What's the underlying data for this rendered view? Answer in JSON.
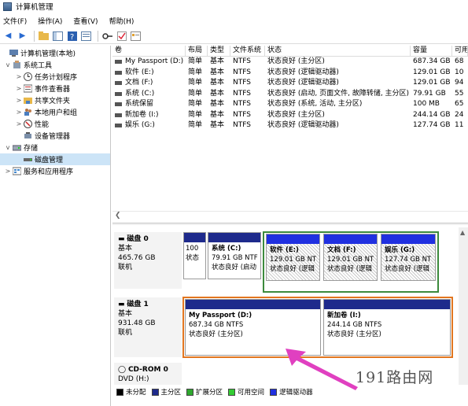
{
  "window": {
    "title": "计算机管理"
  },
  "menu": [
    "文件(F)",
    "操作(A)",
    "查看(V)",
    "帮助(H)"
  ],
  "toolbar": {
    "icons": [
      "back-arrow-icon",
      "forward-arrow-icon",
      "up-folder-icon",
      "show-tree-icon",
      "help-icon",
      "properties-icon",
      "key-icon",
      "check-icon",
      "list-icon"
    ]
  },
  "tree": {
    "items": [
      {
        "label": "计算机管理(本地)",
        "indent": 0,
        "expander": "",
        "icon": "computer-management-icon"
      },
      {
        "label": "系统工具",
        "indent": 1,
        "expander": "v",
        "icon": "tools-icon"
      },
      {
        "label": "任务计划程序",
        "indent": 2,
        "expander": ">",
        "icon": "clock-icon"
      },
      {
        "label": "事件查看器",
        "indent": 2,
        "expander": ">",
        "icon": "event-viewer-icon"
      },
      {
        "label": "共享文件夹",
        "indent": 2,
        "expander": ">",
        "icon": "shared-folder-icon"
      },
      {
        "label": "本地用户和组",
        "indent": 2,
        "expander": ">",
        "icon": "users-icon"
      },
      {
        "label": "性能",
        "indent": 2,
        "expander": ">",
        "icon": "performance-icon"
      },
      {
        "label": "设备管理器",
        "indent": 2,
        "expander": "",
        "icon": "device-manager-icon"
      },
      {
        "label": "存储",
        "indent": 1,
        "expander": "v",
        "icon": "storage-icon"
      },
      {
        "label": "磁盘管理",
        "indent": 2,
        "expander": "",
        "icon": "disk-icon",
        "selected": true
      },
      {
        "label": "服务和应用程序",
        "indent": 1,
        "expander": ">",
        "icon": "services-icon"
      }
    ]
  },
  "volumes": {
    "columns": [
      "卷",
      "布局",
      "类型",
      "文件系统",
      "状态",
      "容量",
      "可用"
    ],
    "rows": [
      [
        "My Passport (D:)",
        "简单",
        "基本",
        "NTFS",
        "状态良好 (主分区)",
        "687.34 GB",
        "68"
      ],
      [
        "软件 (E:)",
        "简单",
        "基本",
        "NTFS",
        "状态良好 (逻辑驱动器)",
        "129.01 GB",
        "10"
      ],
      [
        "文档 (F:)",
        "简单",
        "基本",
        "NTFS",
        "状态良好 (逻辑驱动器)",
        "129.01 GB",
        "94"
      ],
      [
        "系统 (C:)",
        "简单",
        "基本",
        "NTFS",
        "状态良好 (启动, 页面文件, 故障转储, 主分区)",
        "79.91 GB",
        "55"
      ],
      [
        "系统保留",
        "简单",
        "基本",
        "NTFS",
        "状态良好 (系统, 活动, 主分区)",
        "100 MB",
        "65"
      ],
      [
        "新加卷 (I:)",
        "简单",
        "基本",
        "NTFS",
        "状态良好 (主分区)",
        "244.14 GB",
        "24"
      ],
      [
        "娱乐 (G:)",
        "简单",
        "基本",
        "NTFS",
        "状态良好 (逻辑驱动器)",
        "127.74 GB",
        "11"
      ]
    ]
  },
  "disks": [
    {
      "name": "磁盘 0",
      "type": "基本",
      "size": "465.76 GB",
      "status": "联机",
      "partitions": [
        {
          "name": "",
          "size": "100",
          "status": "状态"
        },
        {
          "name": "系统 (C:)",
          "size": "79.91 GB NTF",
          "status": "状态良好 (启动"
        },
        {
          "name": "软件 (E:)",
          "size": "129.01 GB NT",
          "status": "状态良好 (逻辑"
        },
        {
          "name": "文档 (F:)",
          "size": "129.01 GB NT",
          "status": "状态良好 (逻辑"
        },
        {
          "name": "娱乐 (G:)",
          "size": "127.74 GB NT",
          "status": "状态良好 (逻辑"
        }
      ]
    },
    {
      "name": "磁盘 1",
      "type": "基本",
      "size": "931.48 GB",
      "status": "联机",
      "partitions": [
        {
          "name": "My Passport (D:)",
          "size": "687.34 GB NTFS",
          "status": "状态良好 (主分区)"
        },
        {
          "name": "新加卷 (I:)",
          "size": "244.14 GB NTFS",
          "status": "状态良好 (主分区)"
        }
      ]
    },
    {
      "name": "CD-ROM 0",
      "type": "DVD (H:)"
    }
  ],
  "legend": [
    {
      "label": "未分配",
      "color": "#000000"
    },
    {
      "label": "主分区",
      "color": "#1e2a8c"
    },
    {
      "label": "扩展分区",
      "color": "#2fa82f"
    },
    {
      "label": "可用空间",
      "color": "#33cc33"
    },
    {
      "label": "逻辑驱动器",
      "color": "#2030e0"
    }
  ],
  "colors": {
    "primary_bar": "#1e2a8c",
    "logical_bar": "#2030e0",
    "extended_frame": "#3c8a3c",
    "selection_frame": "#e2761f",
    "annotation_arrow": "#e040c0"
  },
  "watermark": "191路由网"
}
